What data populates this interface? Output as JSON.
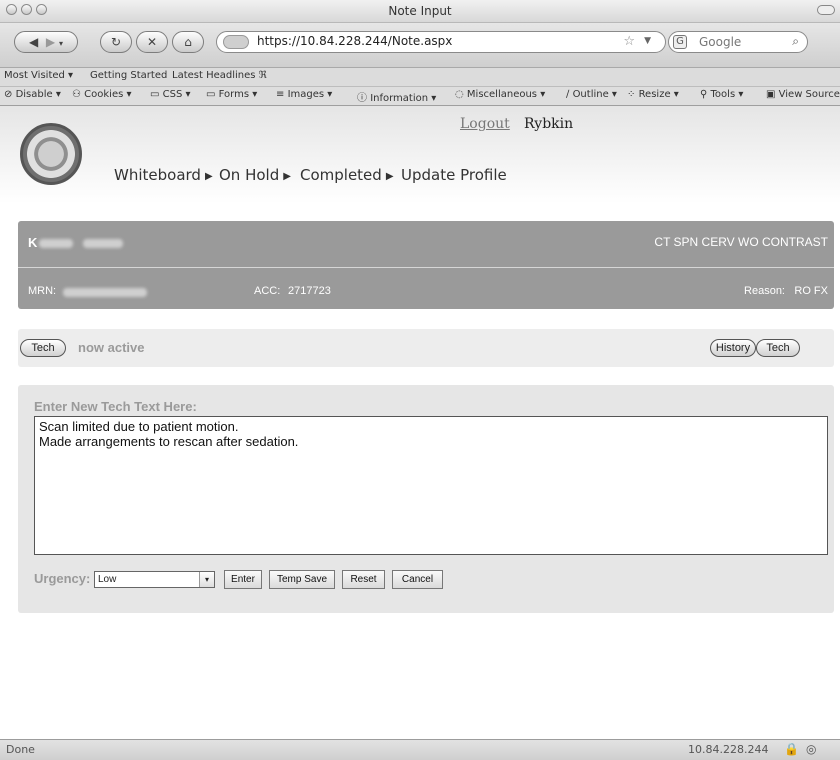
{
  "window": {
    "title": "Note Input"
  },
  "toolbar": {
    "url": "https://10.84.228.244/Note.aspx",
    "search_placeholder": "Google"
  },
  "bookmarks": [
    "Most Visited ▾",
    "Getting Started",
    "Latest Headlines ℜ"
  ],
  "devbar": [
    "Disable ▾",
    "Cookies ▾",
    "CSS ▾",
    "Forms ▾",
    "Images ▾",
    "Information ▾",
    "Miscellaneous ▾",
    "Outline ▾",
    "Resize ▾",
    "Tools ▾",
    "View Source"
  ],
  "header": {
    "logout": "Logout",
    "user": "Rybkin",
    "nav": [
      "Whiteboard",
      "On Hold",
      "Completed",
      "Update Profile"
    ]
  },
  "patient": {
    "name": "K",
    "exam": "CT SPN CERV WO CONTRAST",
    "mrn_label": "MRN:",
    "acc_label": "ACC:",
    "acc_value": "2717723",
    "reason_label": "Reason:",
    "reason_value": "RO FX"
  },
  "status": {
    "tech_button": "Tech",
    "active_text": "now active",
    "history_button": "History",
    "tech_button_right": "Tech"
  },
  "note": {
    "label": "Enter New Tech Text Here:",
    "text": "Scan limited due to patient motion.\nMade arrangements to rescan after sedation.",
    "urgency_label": "Urgency:",
    "urgency_value": "Low",
    "buttons": {
      "enter": "Enter",
      "temp_save": "Temp Save",
      "reset": "Reset",
      "cancel": "Cancel"
    }
  },
  "statusbar": {
    "left": "Done",
    "right": "10.84.228.244"
  }
}
